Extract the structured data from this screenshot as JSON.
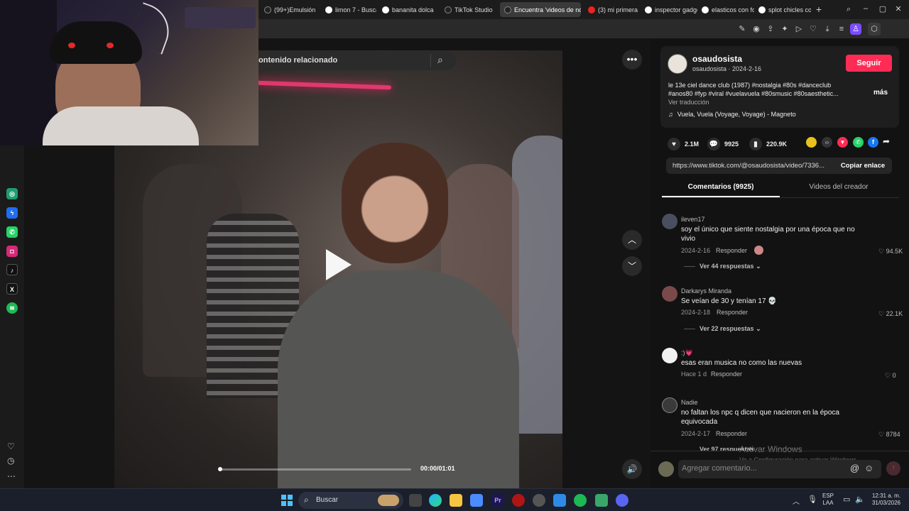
{
  "tabs": [
    {
      "label": "(99+)Emulsión d"
    },
    {
      "label": "limon 7 - Buscar"
    },
    {
      "label": "bananita dolca -"
    },
    {
      "label": "TikTok Studio"
    },
    {
      "label": "Encuentra 'videos de nost"
    },
    {
      "label": "(3) mi primera e"
    },
    {
      "label": "inspector gadge"
    },
    {
      "label": "elasticos con for"
    },
    {
      "label": "splot chicles con"
    }
  ],
  "toolbar": {
    "ai_label": "AI"
  },
  "search": {
    "placeholder": "ontenido relacionado"
  },
  "video": {
    "time": "00:00/01:01",
    "progress": 0.0
  },
  "post": {
    "username": "osaudosista",
    "handle_date": "osaudosista · 2024-2-16",
    "follow_label": "Seguir",
    "caption_line1": "le 13e ciel dance club (1987) #nostalgia #80s #danceclub",
    "caption_line2": "#anos80 #fyp #viral #vuelavuela #80smusic #80saesthetic...",
    "more_label": "más",
    "translate_label": "Ver traducción",
    "music": "Vuela, Vuela (Voyage, Voyage) - Magneto",
    "likes": "2.1M",
    "comments": "9925",
    "saves": "220.9K",
    "url": "https://www.tiktok.com/@osaudosista/video/7336...",
    "copy_label": "Copiar enlace"
  },
  "tabs_panel": {
    "comments_tab": "Comentarios (9925)",
    "creator_tab": "Videos del creador"
  },
  "comments": [
    {
      "user": "ileven17",
      "text1": "soy el único que siente nostalgia por una época que no",
      "text2": "vivio",
      "date": "2024-2-16",
      "reply": "Responder",
      "likes": "94.5K",
      "view_replies": "Ver 44 respuestas"
    },
    {
      "user": "Darkarys Miranda",
      "text1": "Se veían de 30 y tenían 17 💀",
      "date": "2024-2-18",
      "reply": "Responder",
      "likes": "22.1K",
      "view_replies": "Ver 22 respuestas"
    },
    {
      "user": ":)💗",
      "text1": "esas eran musica no como las nuevas",
      "date": "Hace 1 d",
      "reply": "Responder",
      "likes": "0"
    },
    {
      "user": "Nadie",
      "text1": "no faltan los npc q dicen que nacieron en la época",
      "text2": "equivocada",
      "date": "2024-2-17",
      "reply": "Responder",
      "likes": "8784",
      "view_replies": "Ver 97 respuestas"
    }
  ],
  "comment_input": {
    "placeholder": "Agregar comentario..."
  },
  "watermark": {
    "line1": "Activar Windows",
    "line2": "Ve a Configuración para activar Windows."
  },
  "taskbar": {
    "search_label": "Buscar",
    "lang1": "ESP",
    "lang2": "LAA",
    "time": "12:31 a. m.",
    "date": "31/03/2026"
  },
  "colors": {
    "accent": "#fe2c55",
    "bg": "#121212"
  }
}
